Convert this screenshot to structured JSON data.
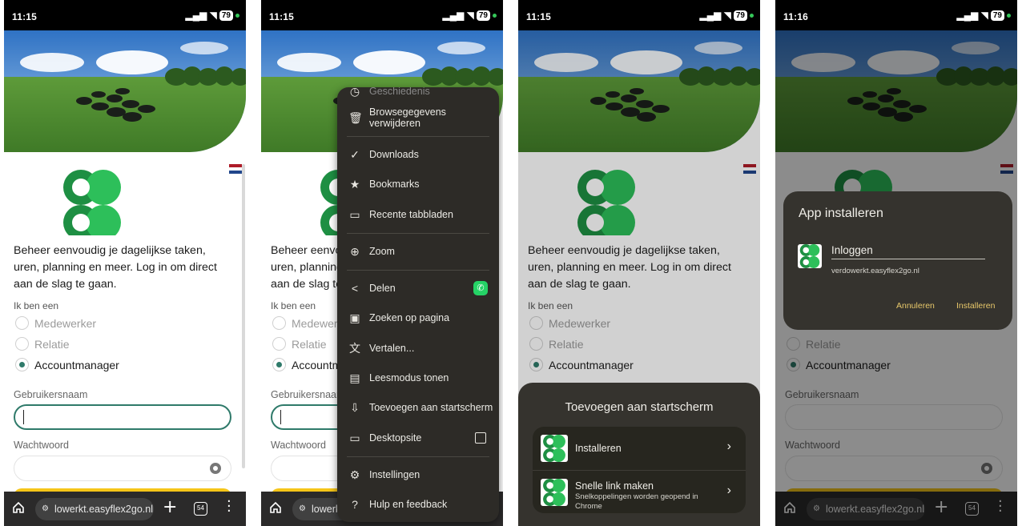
{
  "status": {
    "time1": "11:15",
    "time2": "11:15",
    "time3": "11:15",
    "time4": "11:16",
    "notif": "© ⛐ ⚗ ···",
    "battery": "79"
  },
  "page": {
    "intro": "Beheer eenvoudig je dagelijkse taken, uren, planning en meer. Log in om direct aan de slag te gaan.",
    "role_label": "Ik ben een",
    "roles": [
      "Medewerker",
      "Relatie",
      "Accountmanager"
    ],
    "username_label": "Gebruikersnaam",
    "password_label": "Wachtwoord"
  },
  "browser": {
    "url": "lowerkt.easyflex2go.nl",
    "tabs_count": "54"
  },
  "menu": {
    "items": [
      {
        "label": "Geschiedenis",
        "icon": "history-icon"
      },
      {
        "label": "Browsegegevens verwijderen",
        "icon": "trash-icon"
      },
      {
        "label": "Downloads",
        "icon": "download-icon"
      },
      {
        "label": "Bookmarks",
        "icon": "star-icon"
      },
      {
        "label": "Recente tabbladen",
        "icon": "devices-icon"
      },
      {
        "label": "Zoom",
        "icon": "zoom-icon"
      },
      {
        "label": "Delen",
        "icon": "share-icon"
      },
      {
        "label": "Zoeken op pagina",
        "icon": "find-icon"
      },
      {
        "label": "Vertalen...",
        "icon": "translate-icon"
      },
      {
        "label": "Leesmodus tonen",
        "icon": "reader-icon"
      },
      {
        "label": "Toevoegen aan startscherm",
        "icon": "add-home-icon"
      },
      {
        "label": "Desktopsite",
        "icon": "desktop-icon"
      },
      {
        "label": "Instellingen",
        "icon": "settings-icon"
      },
      {
        "label": "Hulp en feedback",
        "icon": "help-icon"
      }
    ]
  },
  "sheet": {
    "title": "Toevoegen aan startscherm",
    "install_label": "Installeren",
    "shortcut_label": "Snelle link maken",
    "shortcut_sub": "Snelkoppelingen worden geopend in Chrome"
  },
  "dialog": {
    "title": "App installeren",
    "app_name": "Inloggen",
    "app_url": "verdowerkt.easyflex2go.nl",
    "cancel": "Annuleren",
    "install": "Installeren"
  },
  "colors": {
    "brand_green": "#1f9e4b",
    "accent_teal": "#2f7a6a",
    "menu_bg": "#2d2b27",
    "whatsapp": "#25d366",
    "dialog_button": "#e8c86a"
  }
}
